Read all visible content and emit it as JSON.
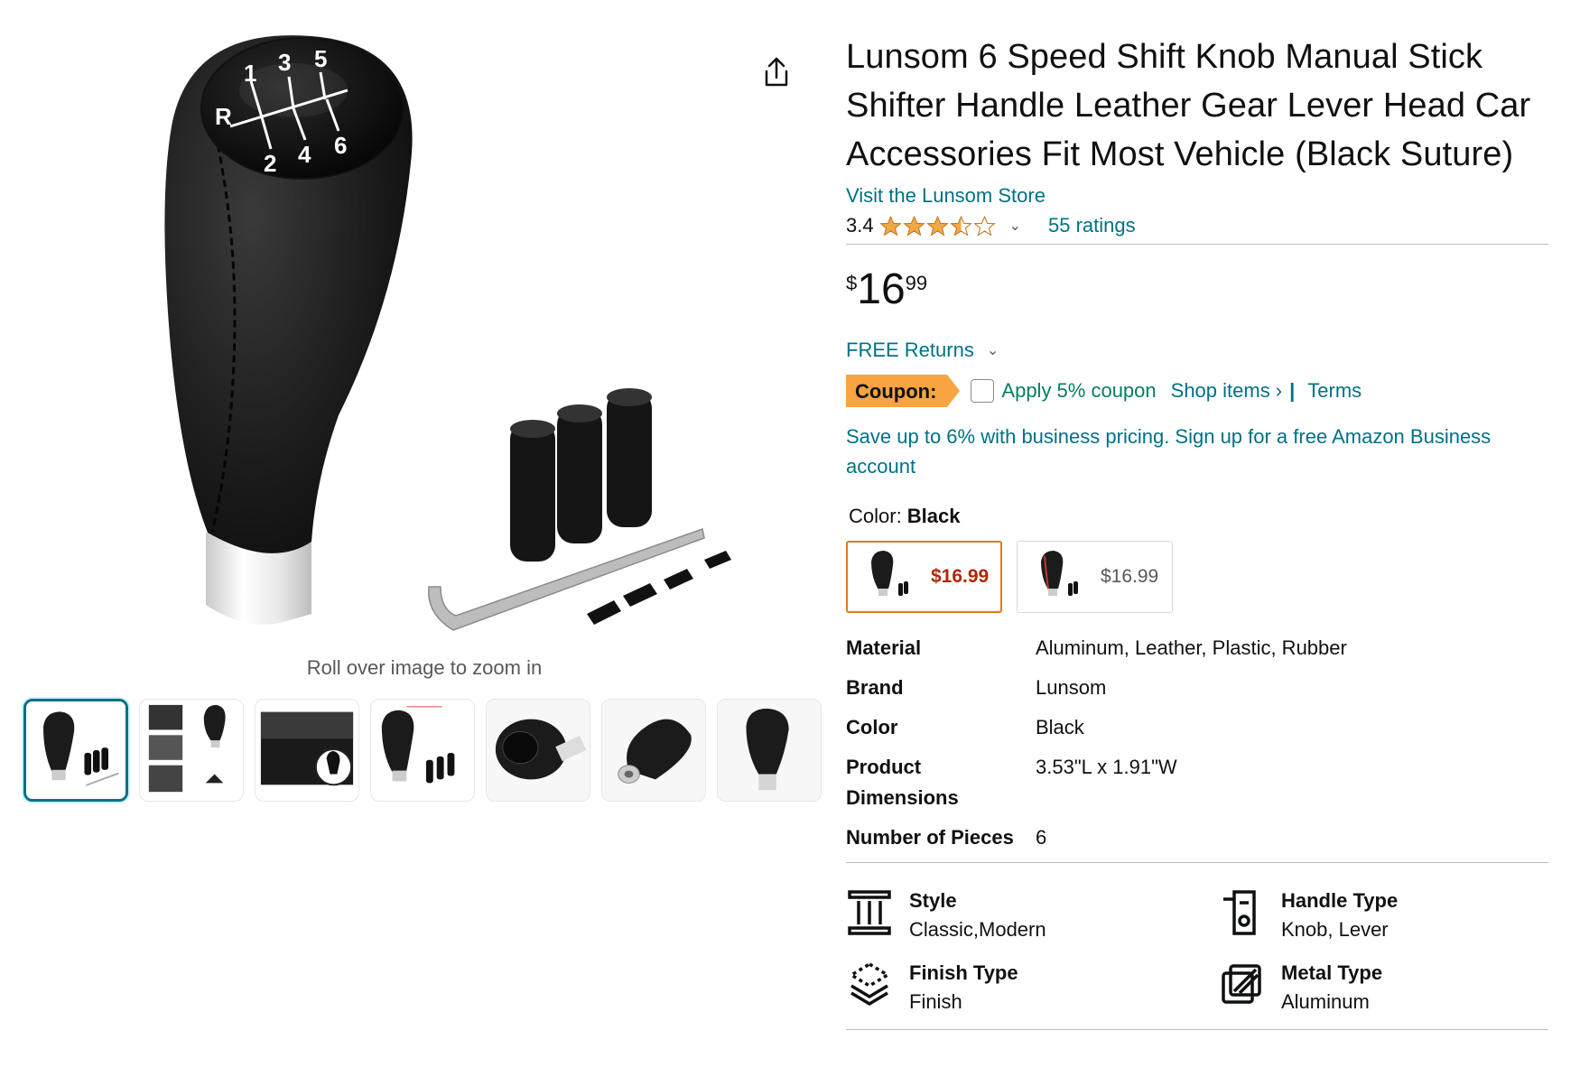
{
  "product": {
    "title": "Lunsom 6 Speed Shift Knob Manual Stick Shifter Handle Leather Gear Lever Head Car Accessories Fit Most Vehicle (Black Suture)",
    "store_link": "Visit the Lunsom Store",
    "rating": "3.4",
    "rating_value": 3.4,
    "ratings_count": "55 ratings",
    "price_symbol": "$",
    "price_whole": "16",
    "price_fraction": "99",
    "returns": "FREE Returns",
    "coupon_label": "Coupon:",
    "coupon_apply": "Apply 5% coupon",
    "shop_items": "Shop items ›",
    "separator": "|",
    "terms": "Terms",
    "business": "Save up to 6% with business pricing. Sign up for a free Amazon Business account",
    "color_label": "Color: ",
    "color_value": "Black"
  },
  "gallery": {
    "zoom_hint": "Roll over image to zoom in",
    "gear_labels": [
      "R",
      "1",
      "3",
      "5",
      "2",
      "4",
      "6"
    ],
    "thumbnail_count": 7
  },
  "swatches": [
    {
      "price": "$16.99",
      "selected": true
    },
    {
      "price": "$16.99",
      "selected": false
    }
  ],
  "specs": [
    {
      "key": "Material",
      "value": "Aluminum, Leather, Plastic, Rubber"
    },
    {
      "key": "Brand",
      "value": "Lunsom"
    },
    {
      "key": "Color",
      "value": "Black"
    },
    {
      "key": "Product Dimensions",
      "value": "3.53\"L x 1.91\"W"
    },
    {
      "key": "Number of Pieces",
      "value": "6"
    }
  ],
  "features": [
    {
      "title": "Style",
      "value": "Classic,Modern",
      "icon": "pillar-icon"
    },
    {
      "title": "Handle Type",
      "value": "Knob, Lever",
      "icon": "handle-icon"
    },
    {
      "title": "Finish Type",
      "value": "Finish",
      "icon": "layers-icon"
    },
    {
      "title": "Metal Type",
      "value": "Aluminum",
      "icon": "metal-icon"
    }
  ],
  "colors": {
    "link": "#007185",
    "coupon_bg": "#f7a441",
    "coupon_green": "#067d62",
    "price_red": "#b12704",
    "swatch_selected": "#e47911",
    "star": "#f3a847"
  }
}
